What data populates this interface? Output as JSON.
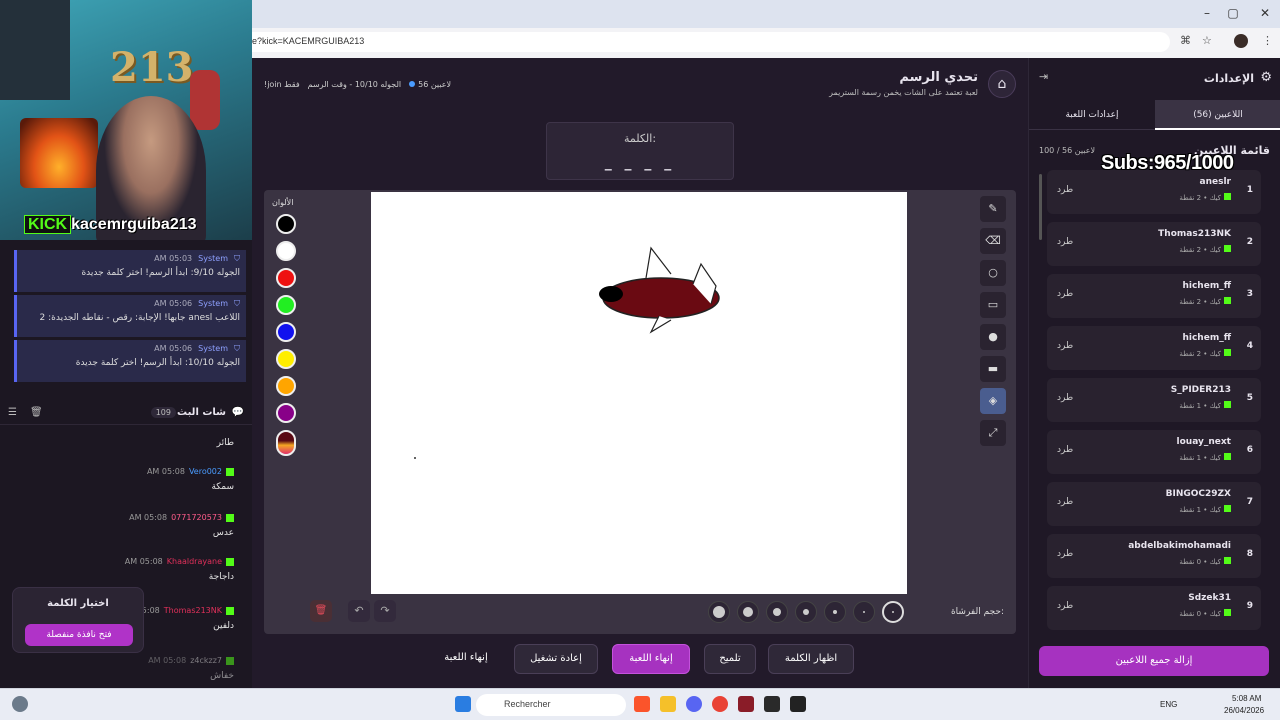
{
  "browser": {
    "url": "e?kick=KACEMRGUIBA213",
    "window_controls": [
      "–",
      "▢",
      "✕"
    ]
  },
  "stream": {
    "overlay_text": "213",
    "kick_brand": "KICK",
    "kick_username": "kacemrguiba213"
  },
  "system_messages": [
    {
      "sender": "System",
      "time": "05:03 AM",
      "text": "الجوله 9/10: ابدأ الرسم! اختر كلمة جديدة"
    },
    {
      "sender": "System",
      "time": "05:06 AM",
      "text": "اللاعب anesl جابها! الإجابة: رقص - نقاطه الجديدة: 2"
    },
    {
      "sender": "System",
      "time": "05:06 AM",
      "text": "الجوله 10/10: ابدأ الرسم! اختر كلمة جديدة"
    }
  ],
  "chat": {
    "title": "شات البث",
    "count": "109",
    "messages": [
      {
        "user": "",
        "time": "",
        "text": "طائر",
        "color": "#ffffff"
      },
      {
        "user": "Vero002",
        "time": "05:08 AM",
        "text": "سمكة",
        "color": "#4a9cff"
      },
      {
        "user": "0771720573",
        "time": "05:08 AM",
        "text": "عدس",
        "color": "#ff5c8a"
      },
      {
        "user": "Khaaldrayane",
        "time": "05:08 AM",
        "text": "داجاجة",
        "color": "#e0305a"
      },
      {
        "user": "Thomas213NK",
        "time": "05:08",
        "text": "دلفين",
        "color": "#e0305a"
      },
      {
        "user": "z4ckzz7",
        "time": "05:08 AM",
        "text": "خفاش",
        "color": "#cccccc"
      }
    ]
  },
  "word_popup": {
    "title": "اختيار الكلمة",
    "button": "فتح نافذة منفصلة"
  },
  "game": {
    "title": "تحدي الرسم",
    "subtitle": "لعبة تعتمد على الشات يخمن رسمة الستريمر",
    "status_players": "56 لاعبين",
    "status_round": "الجوله 10/10 - وقت الرسم",
    "status_join": "!join فقط",
    "word_label": "الكلمة:",
    "word_mask": "_ _ _ _",
    "colors_label": "الألوان",
    "brush_label": "حجم الفرشاة:",
    "colors": [
      "#000000",
      "#ffffff",
      "#ee1111",
      "#22ee22",
      "#1111ee",
      "#ffee00",
      "#ffa500",
      "#880088",
      "#5a0a14"
    ],
    "tools": [
      "pencil-icon",
      "eraser-icon",
      "circle-icon",
      "rectangle-icon",
      "filled-circle-icon",
      "filled-rect-icon",
      "fill-bucket-icon",
      "line-icon"
    ],
    "actions": {
      "show_word": "اظهار الكلمة",
      "hint": "تلميح",
      "end_game_primary": "إنهاء اللعبة",
      "restart": "إعادة تشغيل",
      "end_game": "إنهاء اللعبة"
    }
  },
  "settings": {
    "title": "الإعدادات",
    "tab_players": "اللاعبين (56)",
    "tab_game": "إعدادات اللعبة",
    "players_list_title": "قائمة اللاعبين",
    "players_count": "100 / 56 لاعبين",
    "subs_overlay": "Subs:965/1000",
    "kick_label": "طرد",
    "players": [
      {
        "rank": "1",
        "name": "aneslr",
        "meta": "كيك • 2 نقطة"
      },
      {
        "rank": "2",
        "name": "Thomas213NK",
        "meta": "كيك • 2 نقطة"
      },
      {
        "rank": "3",
        "name": "hichem_ff",
        "meta": "كيك • 2 نقطة"
      },
      {
        "rank": "4",
        "name": "hichem_ff",
        "meta": "كيك • 2 نقطة"
      },
      {
        "rank": "5",
        "name": "S_PIDER213",
        "meta": "كيك • 1 نقطة"
      },
      {
        "rank": "6",
        "name": "louay_next",
        "meta": "كيك • 1 نقطة"
      },
      {
        "rank": "7",
        "name": "BINGOC29ZX",
        "meta": "كيك • 1 نقطة"
      },
      {
        "rank": "8",
        "name": "abdelbakimohamadi",
        "meta": "كيك • 0 نقطة"
      },
      {
        "rank": "9",
        "name": "Sdzek31",
        "meta": "كيك • 0 نقطة"
      }
    ],
    "remove_all": "إزالة جميع اللاعبين"
  },
  "taskbar": {
    "search": "Rechercher",
    "lang": "ENG",
    "time": "5:08 AM",
    "date": "26/04/2026"
  }
}
